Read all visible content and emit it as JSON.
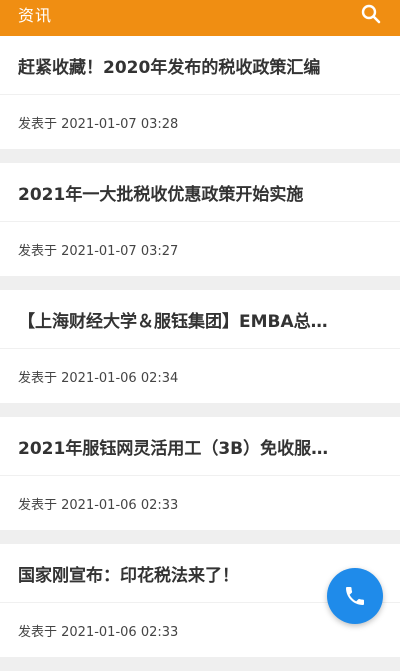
{
  "header": {
    "title": "资讯",
    "search_icon": "search-icon",
    "color": "#f08e12"
  },
  "articles": [
    {
      "title": "赶紧收藏！2020年发布的税收政策汇编",
      "meta": "发表于 2021-01-07 03:28"
    },
    {
      "title": "2021年一大批税收优惠政策开始实施",
      "meta": "发表于 2021-01-07 03:27"
    },
    {
      "title": "【上海财经大学＆服钰集团】EMBA总…",
      "meta": "发表于 2021-01-06 02:34"
    },
    {
      "title": "2021年服钰网灵活用工（3B）免收服…",
      "meta": "发表于 2021-01-06 02:33"
    },
    {
      "title": "国家刚宣布：印花税法来了！",
      "meta": "发表于 2021-01-06 02:33"
    }
  ],
  "fab": {
    "icon": "phone-icon",
    "color": "#1f8bea"
  }
}
